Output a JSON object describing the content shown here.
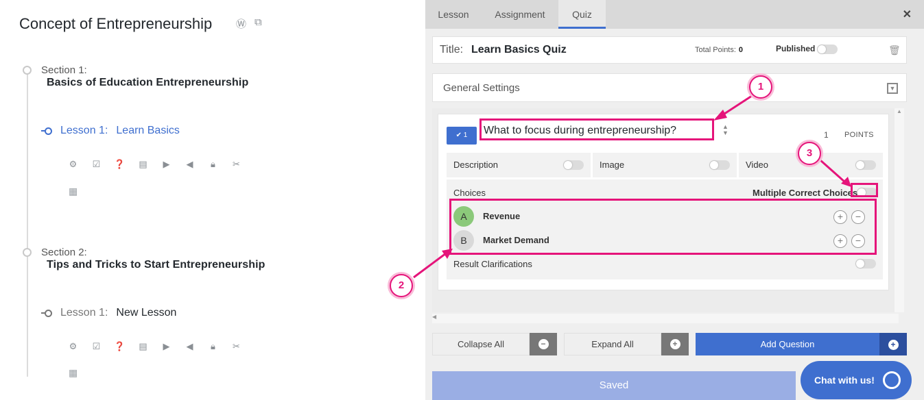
{
  "course": {
    "title": "Concept of Entrepreneurship",
    "sections": [
      {
        "label": "Section 1:",
        "name": "Basics of Education Entrepreneurship",
        "lesson_prefix": "Lesson 1:",
        "lesson_name": "Learn Basics"
      },
      {
        "label": "Section 2:",
        "name": "Tips and Tricks to Start Entrepreneurship",
        "lesson_prefix": "Lesson 1:",
        "lesson_name": "New Lesson"
      }
    ],
    "tool_icons": [
      "gear-icon",
      "checklist-icon",
      "question-icon",
      "document-icon",
      "play-icon",
      "audio-icon",
      "lock-icon",
      "unlink-icon",
      "calendar-icon"
    ]
  },
  "tabs": [
    "Lesson",
    "Assignment",
    "Quiz"
  ],
  "active_tab": "Quiz",
  "quiz": {
    "title_label": "Title:",
    "title_value": "Learn Basics Quiz",
    "total_points_label": "Total Points:",
    "total_points_value": "0",
    "published_label": "Published",
    "general_settings": "General Settings"
  },
  "question": {
    "number": "1",
    "title": "What to focus during entrepreneurship?",
    "points_value": "1",
    "points_label": "POINTS",
    "options": [
      "Description",
      "Image",
      "Video"
    ],
    "choices_label": "Choices",
    "multiple_correct_label": "Multiple Correct Choices",
    "choices": [
      {
        "letter": "A",
        "text": "Revenue",
        "color": "#8bc97a"
      },
      {
        "letter": "B",
        "text": "Market Demand",
        "color": "#d9d9d9"
      }
    ],
    "result_label": "Result Clarifications"
  },
  "buttons": {
    "collapse": "Collapse All",
    "expand": "Expand All",
    "add_question": "Add Question",
    "saved": "Saved",
    "chat": "Chat with us!"
  },
  "annotations": [
    "1",
    "2",
    "3"
  ],
  "colors": {
    "accent": "#3f6fcf",
    "annotation": "#e5147a"
  }
}
